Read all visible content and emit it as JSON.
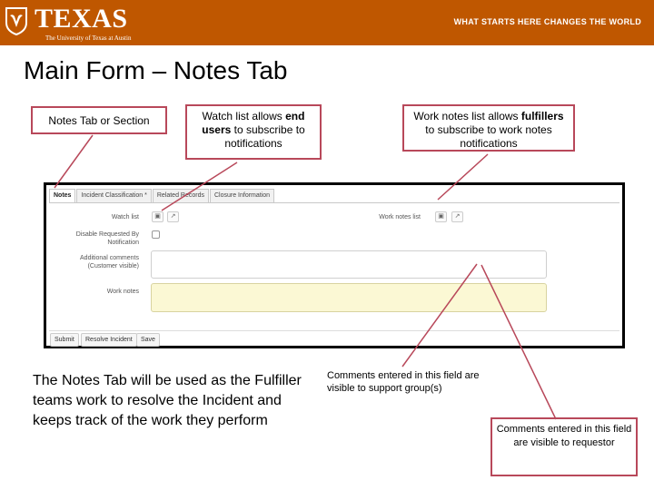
{
  "header": {
    "logo_word": "TEXAS",
    "logo_subtitle": "The University of Texas at Austin",
    "tagline": "WHAT STARTS HERE CHANGES THE WORLD",
    "color": "#bf5700"
  },
  "slide_title": "Main Form – Notes Tab",
  "callouts": {
    "notes_tab": "Notes Tab or Section",
    "watch_list": {
      "prefix": "Watch list allows ",
      "bold": "end users",
      "suffix": " to subscribe to notifications"
    },
    "work_notes_list": {
      "prefix": "Work notes list allows ",
      "bold": "fulfillers",
      "suffix": " to subscribe to work notes notifications"
    },
    "comments_support": "Comments entered in this field are visible to support group(s)",
    "comments_requestor": "Comments entered in this field are visible to requestor",
    "border_color": "#b8485a"
  },
  "form": {
    "tabs": [
      "Notes",
      "Incident Classification *",
      "Related Records",
      "Closure Information"
    ],
    "active_tab": "Notes",
    "watch_list_label": "Watch list",
    "work_notes_list_label": "Work notes list",
    "disable_requested_label_1": "Disable Requested By",
    "disable_requested_label_2": "Notification",
    "additional_comments_label_1": "Additional comments",
    "additional_comments_label_2": "(Customer visible)",
    "work_notes_label": "Work notes",
    "work_notes_color": "#fbf8d4",
    "buttons": [
      "Submit",
      "Resolve Incident",
      "Save"
    ],
    "icons": [
      "lock-icon",
      "unlock-icon"
    ]
  },
  "body_text": "The Notes Tab will be used as the Fulfiller teams work to resolve the Incident and keeps track of the work they perform"
}
